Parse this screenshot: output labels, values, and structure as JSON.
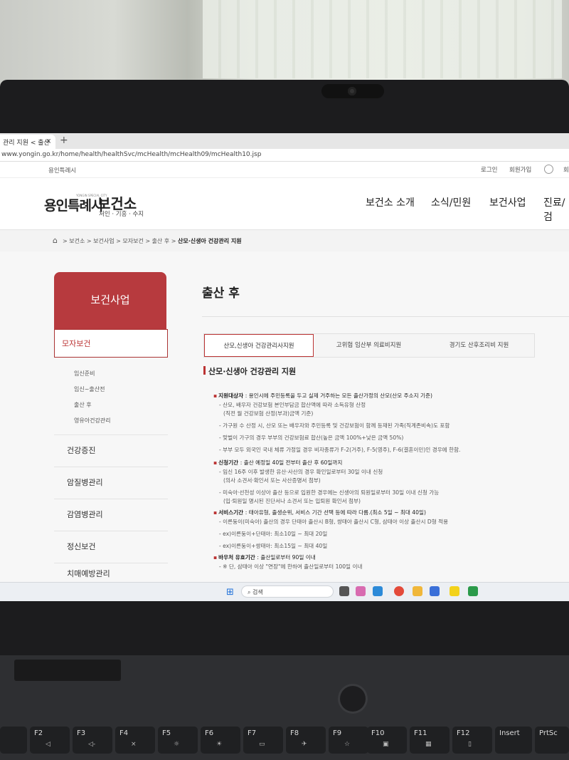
{
  "browser": {
    "tab_title": "관리 지원 < 출산",
    "tab_close": "×",
    "new_tab": "+",
    "url": "www.yongin.go.kr/home/health/healthSvc/mcHealth/mcHealth09/mcHealth10.jsp"
  },
  "site": {
    "util_city": "용인특례시",
    "login": "로그인",
    "join": "회원가입",
    "more": "회",
    "logo_city": "용인특례시",
    "logo_tiny": "YONGIN SPECIAL CITY",
    "logo_title": "보건소",
    "logo_sub": "처인 · 기흥 · 수지",
    "gnb": [
      "보건소 소개",
      "소식/민원",
      "보건사업",
      "진료/검"
    ]
  },
  "breadcrumb": {
    "home_icon": "home-icon",
    "path": "> 보건소 > 보건사업 > 모자보건 > 출산 후 >",
    "current": "산모·신생아 건강관리 지원"
  },
  "lnb": {
    "title": "보건사업",
    "active": "모자보건",
    "sub": [
      "임신준비",
      "임신~출산전",
      "출산 후",
      "영유아건강관리"
    ],
    "items": [
      "건강증진",
      "암질병관리",
      "감염병관리",
      "정신보건",
      "치매예방관리"
    ]
  },
  "content": {
    "title": "출산 후",
    "tabs": [
      "산모,신생아 건강관리사지원",
      "고위험 임산부 의료비지원",
      "경기도 산후조리비 지원"
    ],
    "section": "산모·신생아 건강관리 지원",
    "h1": "지원대상자",
    "h1_text": ": 용인시에 주민등록을 두고 실제 거주하는 모든 출산가정의 산모(산모 주소지 기준)",
    "h1_items": [
      "- 산모, 배우자 건강보험 본인부담금 합산액에 따라 소득유형 산정",
      "(직전 월 건강보험 산정(부과)금액 기준)",
      "- 가구원 수 산정 시, 산모 또는 배우자와 주민등록 및 건강보험이 함께 등재된 가족(직계존비속)도 포함",
      "- 맞벌이 가구의 경우 부부의 건강보험료 합산(높은 금액 100%+낮은 금액 50%)",
      "- 부부 모두 외국인 국내 체류 가정일 경우 비자종류가 F-2(거주), F-5(영주), F-6(결혼이민)인 경우에 한함."
    ],
    "h2": "신청기간",
    "h2_text": ": 출산 예정일 40일 전부터 출산 후 60일까지",
    "h2_items": [
      "- 임신 16주 이후 발생한 유산·사산의 경우 확인일로부터 30일 이내 신청",
      "(의사 소견서·확인서 또는 사산증명서 첨부)",
      "- 미숙아·선천성 이상아 출산 등으로 입원한 경우에는 신생아의 퇴원일로부터 30일 이내 신청 가능",
      "(입·퇴원일 명시된 진단서나 소견서 또는 입퇴원 확인서 첨부)"
    ],
    "h3": "서비스기간",
    "h3_text": ": 태아유형, 출생순위, 서비스 기간 선택 등에 따라 다름.(최소 5일 ~ 최대 40일)",
    "h3_items": [
      "- 이른둥이(미숙아) 출산의 경우 단태아 출산시 B형, 쌍태아 출산시 C형, 삼태아 이상 출산시 D형 적용",
      "- ex)이른둥이+단태아: 최소10일 ~ 최대 20일",
      "- ex)이른둥이+쌍태아: 최소15일 ~ 최대 40일"
    ],
    "h4": "바우처 유효기간",
    "h4_text": ": 출산일로부터 90일 이내",
    "h4_items": [
      "- ※ 단, 삼태아 이상 \"연장\"에 한하여 출산일로부터 100일 이내"
    ]
  },
  "taskbar": {
    "search": "검색"
  },
  "keyboard": {
    "keys": [
      "F2",
      "F3",
      "F4",
      "F5",
      "F6",
      "F7",
      "F8",
      "F9",
      "F10",
      "F11",
      "F12",
      "Insert",
      "PrtSc"
    ]
  },
  "colors": {
    "accent": "#b73a3e",
    "page_bg": "#f7f7f7",
    "bezel": "#1c1c1e"
  }
}
